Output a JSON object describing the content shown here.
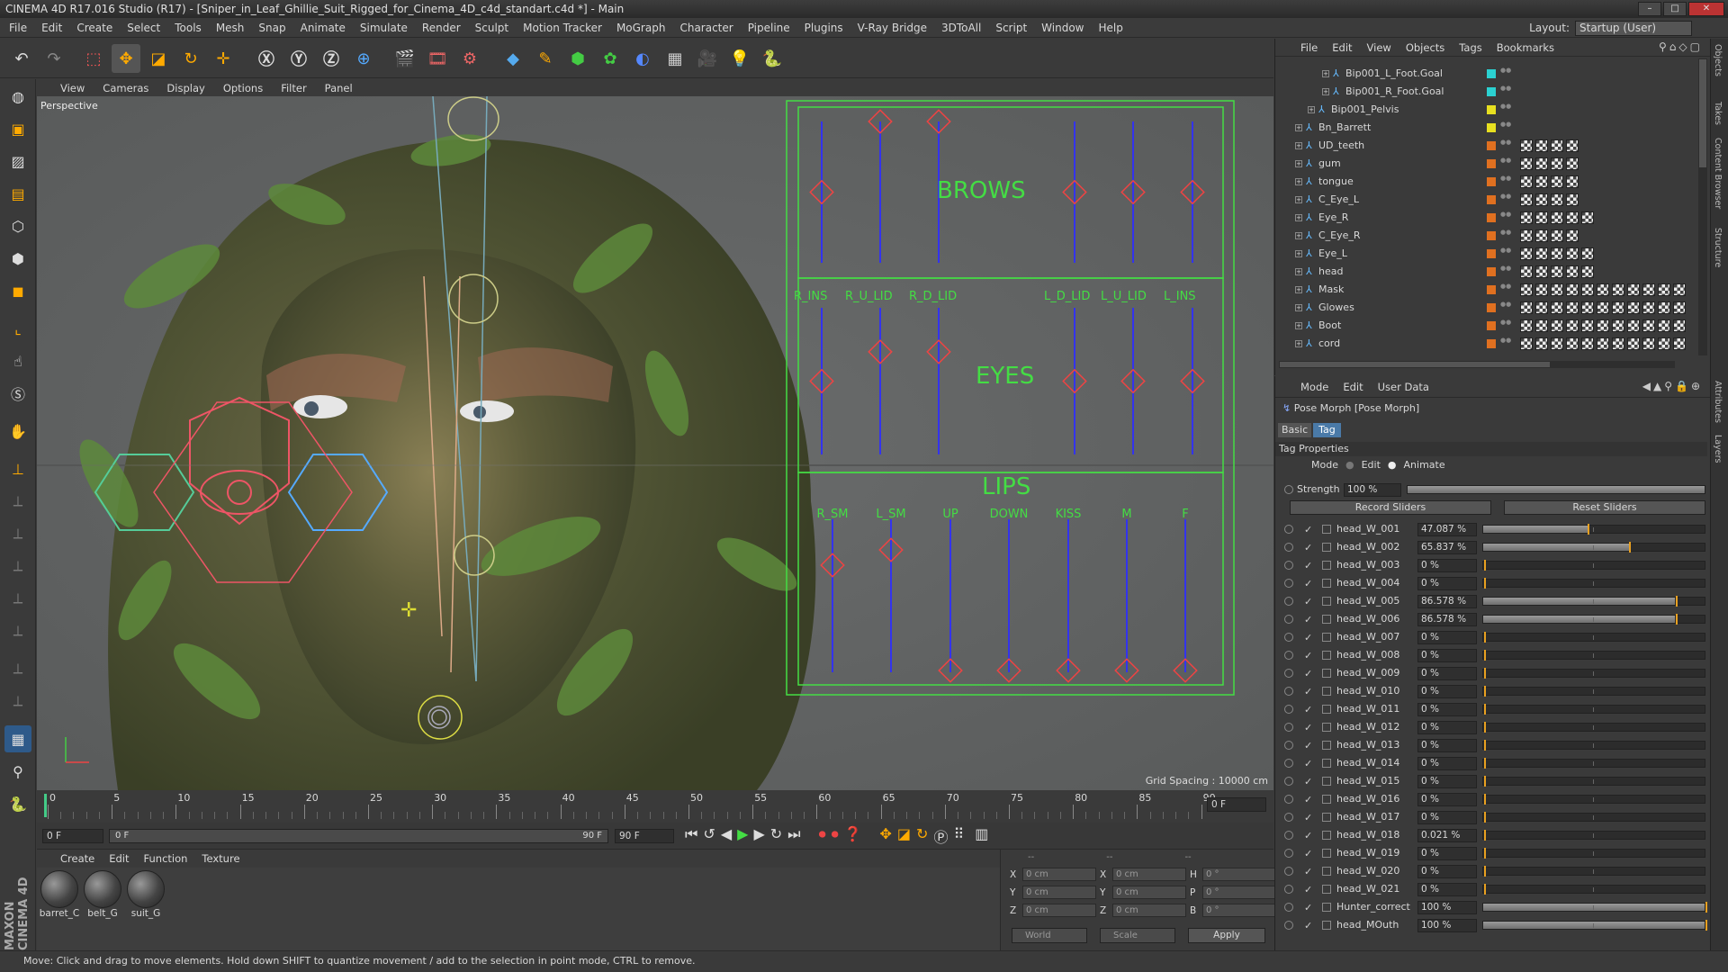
{
  "title": "CINEMA 4D R17.016 Studio (R17) - [Sniper_in_Leaf_Ghillie_Suit_Rigged_for_Cinema_4D_c4d_standart.c4d *] - Main",
  "menu": [
    "File",
    "Edit",
    "Create",
    "Select",
    "Tools",
    "Mesh",
    "Snap",
    "Animate",
    "Simulate",
    "Render",
    "Sculpt",
    "Motion Tracker",
    "MoGraph",
    "Character",
    "Pipeline",
    "Plugins",
    "V-Ray Bridge",
    "3DToAll",
    "Script",
    "Window",
    "Help"
  ],
  "layout": {
    "label": "Layout:",
    "value": "Startup (User)"
  },
  "viewport": {
    "menu": [
      "View",
      "Cameras",
      "Display",
      "Options",
      "Filter",
      "Panel"
    ],
    "label": "Perspective",
    "grid_spacing": "Grid Spacing : 10000 cm"
  },
  "rig": {
    "brows": "BROWS",
    "eyes": "EYES",
    "lips": "LIPS",
    "eye_labels": [
      "R_INS",
      "R_U_LID",
      "R_D_LID",
      "L_D_LID",
      "L_U_LID",
      "L_INS"
    ],
    "lip_labels": [
      "R_SM",
      "L_SM",
      "UP",
      "DOWN",
      "KISS",
      "M",
      "F"
    ]
  },
  "timeline": {
    "ticks": [
      "0",
      "5",
      "10",
      "15",
      "20",
      "25",
      "30",
      "35",
      "40",
      "45",
      "50",
      "55",
      "60",
      "65",
      "70",
      "75",
      "80",
      "85",
      "90"
    ],
    "current_frame": "0 F",
    "start": "0 F",
    "range_start": "0 F",
    "range_end": "90 F",
    "end": "90 F"
  },
  "material": {
    "menu": [
      "Create",
      "Edit",
      "Function",
      "Texture"
    ],
    "items": [
      "barret_C",
      "belt_G",
      "suit_G"
    ]
  },
  "coords": {
    "headers": [
      "--",
      "--",
      "--"
    ],
    "rows": [
      {
        "a": "X",
        "av": "0 cm",
        "b": "X",
        "bv": "0 cm",
        "c": "H",
        "cv": "0 °"
      },
      {
        "a": "Y",
        "av": "0 cm",
        "b": "Y",
        "bv": "0 cm",
        "c": "P",
        "cv": "0 °"
      },
      {
        "a": "Z",
        "av": "0 cm",
        "b": "Z",
        "bv": "0 cm",
        "c": "B",
        "cv": "0 °"
      }
    ],
    "world": "World",
    "scale": "Scale",
    "apply": "Apply"
  },
  "status": "Move: Click and drag to move elements. Hold down SHIFT to quantize movement / add to the selection in point mode, CTRL to remove.",
  "objects": {
    "menu": [
      "File",
      "Edit",
      "View",
      "Objects",
      "Tags",
      "Bookmarks"
    ],
    "items": [
      {
        "name": "Bip001_L_Foot.Goal",
        "indent": 64,
        "color": "#2bd1d1",
        "tags": 0
      },
      {
        "name": "Bip001_R_Foot.Goal",
        "indent": 64,
        "color": "#2bd1d1",
        "tags": 0
      },
      {
        "name": "Bip001_Pelvis",
        "indent": 48,
        "color": "#e8e020",
        "tags": 0
      },
      {
        "name": "Bn_Barrett",
        "indent": 34,
        "color": "#e8e020",
        "tags": 0
      },
      {
        "name": "UD_teeth",
        "indent": 34,
        "color": "#e07020",
        "tags": 4
      },
      {
        "name": "gum",
        "indent": 34,
        "color": "#e07020",
        "tags": 4
      },
      {
        "name": "tongue",
        "indent": 34,
        "color": "#e07020",
        "tags": 4
      },
      {
        "name": "C_Eye_L",
        "indent": 34,
        "color": "#e07020",
        "tags": 4
      },
      {
        "name": "Eye_R",
        "indent": 34,
        "color": "#e07020",
        "tags": 5
      },
      {
        "name": "C_Eye_R",
        "indent": 34,
        "color": "#e07020",
        "tags": 4
      },
      {
        "name": "Eye_L",
        "indent": 34,
        "color": "#e07020",
        "tags": 5
      },
      {
        "name": "head",
        "indent": 34,
        "color": "#e07020",
        "tags": 5
      },
      {
        "name": "Mask",
        "indent": 34,
        "color": "#e07020",
        "tags": 11
      },
      {
        "name": "Glowes",
        "indent": 34,
        "color": "#e07020",
        "tags": 11
      },
      {
        "name": "Boot",
        "indent": 34,
        "color": "#e07020",
        "tags": 11
      },
      {
        "name": "cord",
        "indent": 34,
        "color": "#e07020",
        "tags": 11
      }
    ]
  },
  "attributes": {
    "menu": [
      "Mode",
      "Edit",
      "User Data"
    ],
    "title": "Pose Morph [Pose Morph]",
    "tabs": [
      "Basic",
      "Tag"
    ],
    "section": "Tag Properties",
    "mode_label": "Mode",
    "mode_edit": "Edit",
    "mode_animate": "Animate",
    "strength_label": "Strength",
    "strength": "100 %",
    "record": "Record Sliders",
    "reset": "Reset Sliders",
    "morphs": [
      {
        "name": "head_W_001",
        "value": "47.087 %",
        "level": 0.471
      },
      {
        "name": "head_W_002",
        "value": "65.837 %",
        "level": 0.658
      },
      {
        "name": "head_W_003",
        "value": "0 %",
        "level": 0
      },
      {
        "name": "head_W_004",
        "value": "0 %",
        "level": 0
      },
      {
        "name": "head_W_005",
        "value": "86.578 %",
        "level": 0.866
      },
      {
        "name": "head_W_006",
        "value": "86.578 %",
        "level": 0.866
      },
      {
        "name": "head_W_007",
        "value": "0 %",
        "level": 0
      },
      {
        "name": "head_W_008",
        "value": "0 %",
        "level": 0
      },
      {
        "name": "head_W_009",
        "value": "0 %",
        "level": 0
      },
      {
        "name": "head_W_010",
        "value": "0 %",
        "level": 0
      },
      {
        "name": "head_W_011",
        "value": "0 %",
        "level": 0
      },
      {
        "name": "head_W_012",
        "value": "0 %",
        "level": 0
      },
      {
        "name": "head_W_013",
        "value": "0 %",
        "level": 0
      },
      {
        "name": "head_W_014",
        "value": "0 %",
        "level": 0
      },
      {
        "name": "head_W_015",
        "value": "0 %",
        "level": 0
      },
      {
        "name": "head_W_016",
        "value": "0 %",
        "level": 0
      },
      {
        "name": "head_W_017",
        "value": "0 %",
        "level": 0
      },
      {
        "name": "head_W_018",
        "value": "0.021 %",
        "level": 0.0002
      },
      {
        "name": "head_W_019",
        "value": "0 %",
        "level": 0
      },
      {
        "name": "head_W_020",
        "value": "0 %",
        "level": 0
      },
      {
        "name": "head_W_021",
        "value": "0 %",
        "level": 0
      },
      {
        "name": "Hunter_correct",
        "value": "100 %",
        "level": 1
      },
      {
        "name": "head_MOuth",
        "value": "100 %",
        "level": 1
      }
    ]
  },
  "side_tabs": [
    "Objects",
    "Takes",
    "Content Browser",
    "Structure",
    "Attributes",
    "Layers"
  ],
  "maxon": "MAXON CINEMA 4D"
}
